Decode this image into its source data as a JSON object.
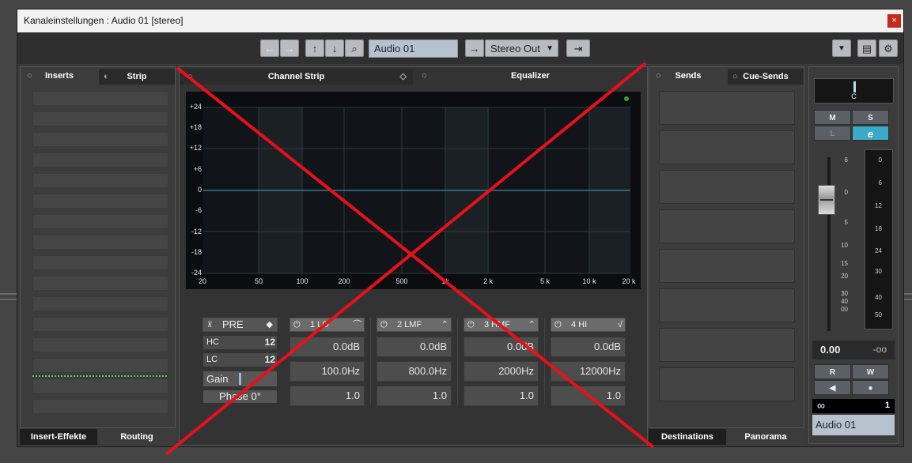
{
  "window": {
    "title": "Kanaleinstellungen : Audio 01 [stereo]",
    "close_glyph": "×"
  },
  "toolbar": {
    "back_glyph": "←",
    "forward_glyph": "→",
    "up_glyph": "↑",
    "down_glyph": "↓",
    "search_glyph": "⌕",
    "channel_name": "Audio 01",
    "output_arrow": "→",
    "output": "Stereo Out",
    "dropdown_glyph": "▼",
    "route_glyph": "⇥",
    "menu_glyph": "▼",
    "settings_glyph": "⚙"
  },
  "inserts": {
    "tab1": "Inserts",
    "tab2": "Strip",
    "bottom_tab1": "Insert-Effekte",
    "bottom_tab2": "Routing"
  },
  "center": {
    "tab1": "Channel Strip",
    "tab2": "Equalizer"
  },
  "eq": {
    "y_labels": [
      "+24",
      "+18",
      "+12",
      "+6",
      "0",
      "-6",
      "-12",
      "-18",
      "-24"
    ],
    "x_labels": [
      "20",
      "50",
      "100",
      "200",
      "500",
      "1k",
      "2 k",
      "5 k",
      "10 k",
      "20 k"
    ],
    "pre": {
      "label": "PRE",
      "hc": "HC",
      "lc": "LC",
      "hc_value": "12",
      "lc_value": "12",
      "gain": "Gain",
      "phase": "Phase 0°"
    },
    "bands": [
      {
        "name": "1 LO",
        "gain": "0.0dB",
        "freq": "100.0Hz",
        "q": "1.0"
      },
      {
        "name": "2 LMF",
        "gain": "0.0dB",
        "freq": "800.0Hz",
        "q": "1.0"
      },
      {
        "name": "3 HMF",
        "gain": "0.0dB",
        "freq": "2000Hz",
        "q": "1.0"
      },
      {
        "name": "4 HI",
        "gain": "0.0dB",
        "freq": "12000Hz",
        "q": "1.0"
      }
    ]
  },
  "sends": {
    "tab1": "Sends",
    "tab2": "Cue-Sends",
    "bottom_tab1": "Destinations",
    "bottom_tab2": "Panorama"
  },
  "fader": {
    "pan": "C",
    "mute": "M",
    "solo": "S",
    "listen": "L",
    "edit": "e",
    "read": "R",
    "write": "W",
    "monitor_glyph": "◀",
    "record_glyph": "●",
    "fader_scale": [
      "6",
      "0",
      "5",
      "10",
      "15",
      "20",
      "30",
      "40",
      "00"
    ],
    "meter_scale": [
      "0",
      "6",
      "12",
      "18",
      "24",
      "30",
      "40",
      "50"
    ],
    "volume": "0.00",
    "peak": "-oo",
    "link_glyph": "∞",
    "channel_number": "1",
    "channel_name": "Audio 01"
  },
  "colors": {
    "overlay_cross": "#e8101a",
    "edit_button": "#3ba9c8",
    "meter_green": "#3fc23f"
  }
}
